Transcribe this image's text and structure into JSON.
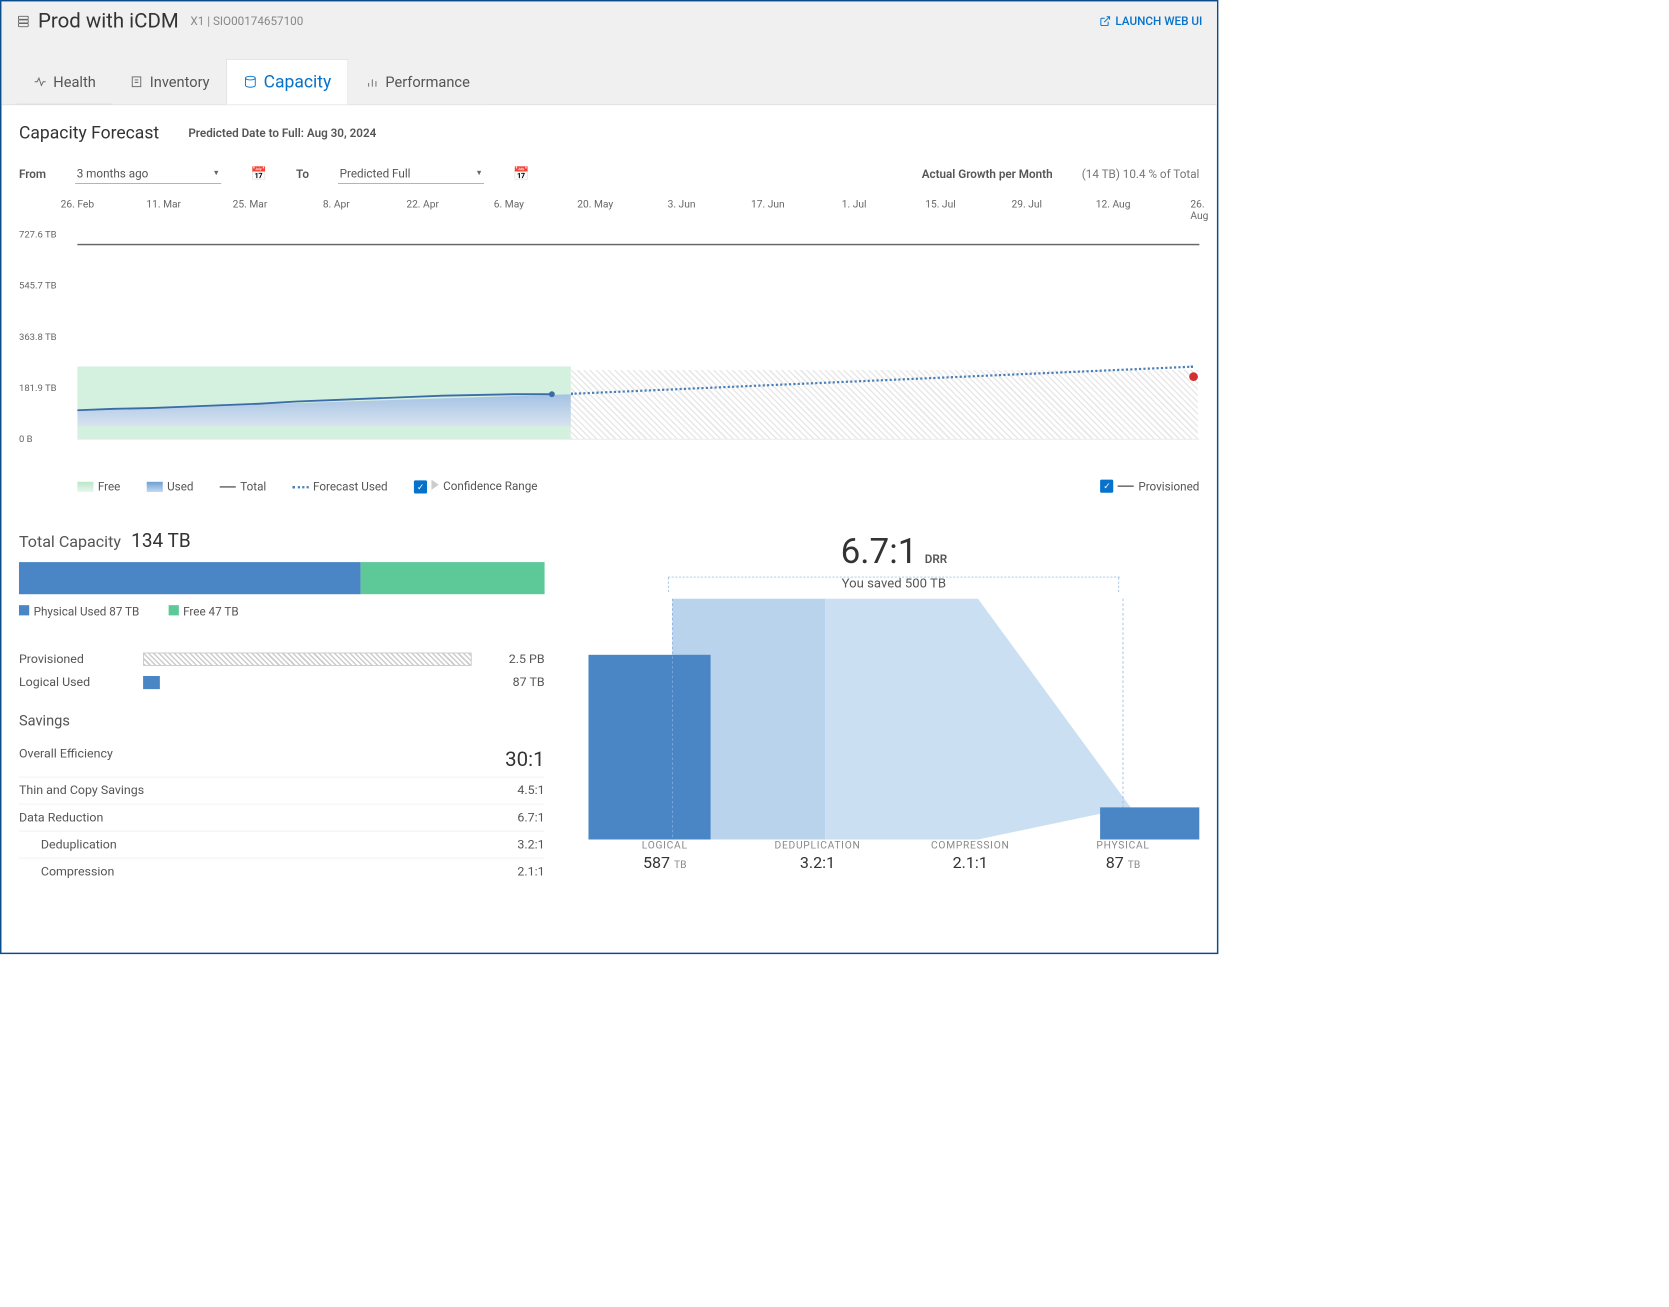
{
  "header": {
    "title": "Prod with iCDM",
    "subtitle": "X1 | SIO00174657100",
    "launch_label": "LAUNCH WEB UI"
  },
  "tabs": {
    "health": "Health",
    "inventory": "Inventory",
    "capacity": "Capacity",
    "performance": "Performance"
  },
  "forecast": {
    "title": "Capacity Forecast",
    "predicted_label": "Predicted Date to Full: Aug 30, 2024",
    "from_label": "From",
    "from_value": "3 months ago",
    "to_label": "To",
    "to_value": "Predicted Full",
    "growth_label": "Actual Growth per Month",
    "growth_value": "(14 TB) 10.4 % of Total"
  },
  "chart_data": {
    "type": "area",
    "x_ticks": [
      "26. Feb",
      "11. Mar",
      "25. Mar",
      "8. Apr",
      "22. Apr",
      "6. May",
      "20. May",
      "3. Jun",
      "17. Jun",
      "1. Jul",
      "15. Jul",
      "29. Jul",
      "12. Aug",
      "26. Aug"
    ],
    "y_ticks": [
      "727.6 TB",
      "545.7 TB",
      "363.8 TB",
      "181.9 TB",
      "0 B"
    ],
    "ylim": [
      0,
      727.6
    ],
    "series": [
      {
        "name": "Total",
        "style": "line",
        "value_constant": 134
      },
      {
        "name": "Provisioned",
        "style": "line",
        "value_constant": 650
      },
      {
        "name": "Used",
        "style": "area",
        "range": "past",
        "start": 45,
        "end": 87
      },
      {
        "name": "Free",
        "style": "area",
        "range": "past",
        "start": 89,
        "end": 47
      },
      {
        "name": "Forecast Used",
        "style": "dotted",
        "range": "future",
        "start": 87,
        "end": 134
      },
      {
        "name": "Confidence Range",
        "style": "hatched",
        "range": "future"
      }
    ],
    "cutoff_index_pct": 44,
    "full_point": {
      "date": "Aug 30, 2024",
      "value": 134
    }
  },
  "legend": {
    "free": "Free",
    "used": "Used",
    "total": "Total",
    "forecast_used": "Forecast Used",
    "confidence": "Confidence Range",
    "provisioned": "Provisioned"
  },
  "total_capacity": {
    "label": "Total Capacity",
    "value": "134 TB",
    "physical_used_label": "Physical Used 87 TB",
    "free_label": "Free 47 TB"
  },
  "bars": {
    "provisioned_label": "Provisioned",
    "provisioned_value": "2.5 PB",
    "logical_used_label": "Logical Used",
    "logical_used_value": "87 TB"
  },
  "savings": {
    "title": "Savings",
    "overall_label": "Overall Efficiency",
    "overall_value": "30:1",
    "thin_label": "Thin and Copy Savings",
    "thin_value": "4.5:1",
    "dr_label": "Data Reduction",
    "dr_value": "6.7:1",
    "dedup_label": "Deduplication",
    "dedup_value": "3.2:1",
    "comp_label": "Compression",
    "comp_value": "2.1:1"
  },
  "drr": {
    "ratio": "6.7:1",
    "suffix": "DRR",
    "saved": "You saved 500 TB",
    "stages": {
      "logical_label": "LOGICAL",
      "logical_value": "587",
      "logical_unit": "TB",
      "dedup_label": "DEDUPLICATION",
      "dedup_value": "3.2:1",
      "comp_label": "COMPRESSION",
      "comp_value": "2.1:1",
      "physical_label": "PHYSICAL",
      "physical_value": "87",
      "physical_unit": "TB"
    }
  }
}
